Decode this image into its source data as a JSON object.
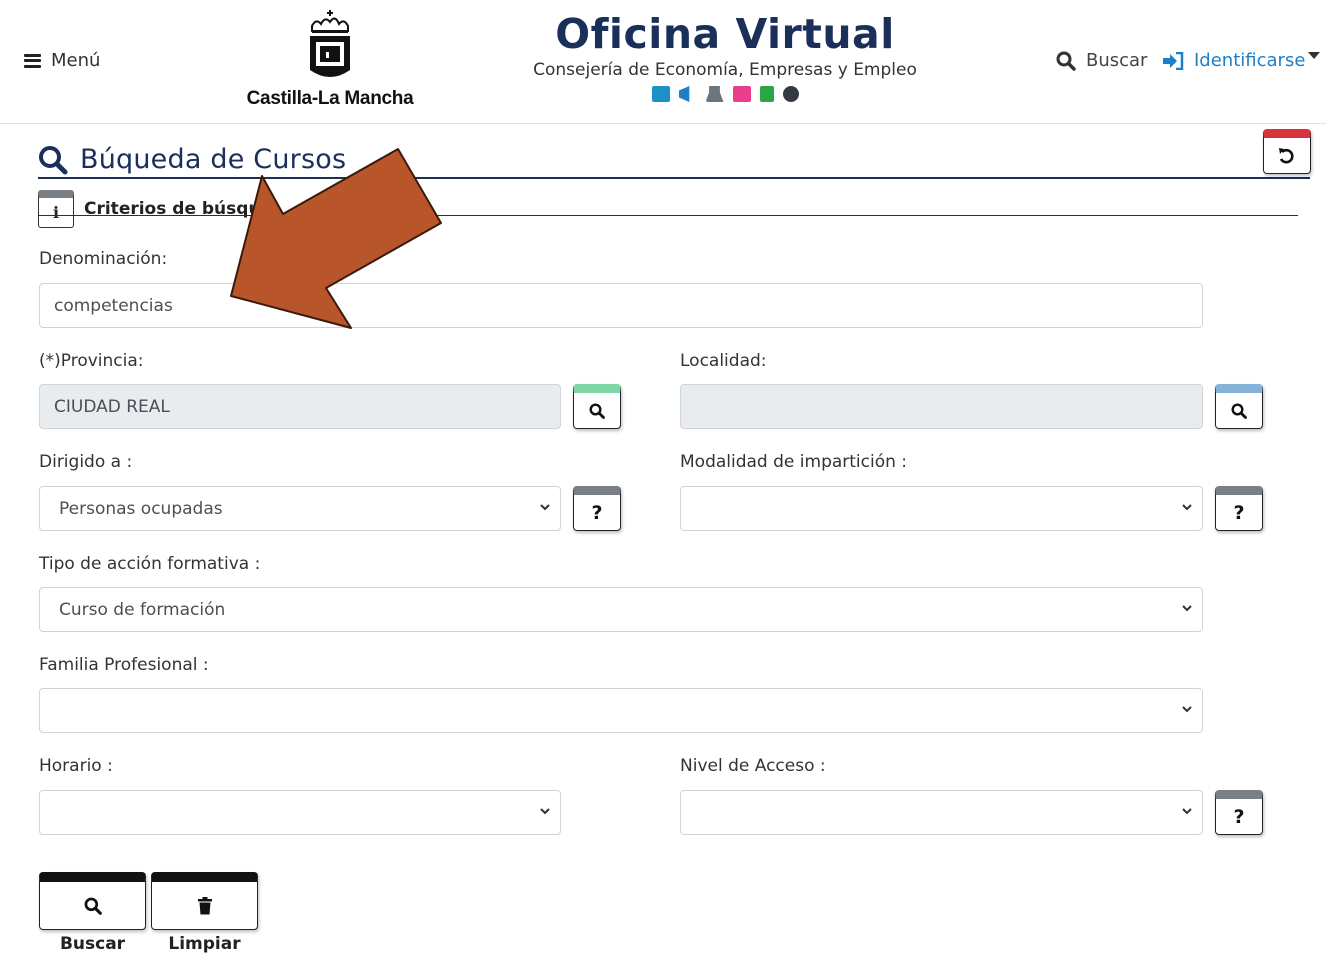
{
  "header": {
    "menu_label": "Menú",
    "logo_text": "Castilla-La Mancha",
    "brand_title": "Oficina Virtual",
    "brand_subtitle": "Consejería de Economía, Empresas y Empleo",
    "brand_icons": [
      {
        "icon": "id-card-icon",
        "color": "#1e90c8"
      },
      {
        "icon": "megaphone-icon",
        "color": "#1e7ec8"
      },
      {
        "icon": "graduate-icon",
        "color": "#6c757d"
      },
      {
        "icon": "list-icon",
        "color": "#e83e8c"
      },
      {
        "icon": "clipboard-icon",
        "color": "#28a745"
      },
      {
        "icon": "cogs-icon",
        "color": "#343a40"
      }
    ],
    "search_label": "Buscar",
    "login_label": "Identificarse"
  },
  "page": {
    "title": "Búqueda de Cursos",
    "criteria_heading": "Criterios de búsque"
  },
  "form": {
    "denominacion": {
      "label": "Denominación:",
      "value": "competencias"
    },
    "provincia": {
      "label": "(*)Provincia:",
      "value": "CIUDAD REAL"
    },
    "localidad": {
      "label": "Localidad:",
      "value": ""
    },
    "dirigido": {
      "label": "Dirigido a :",
      "value": "Personas ocupadas"
    },
    "modalidad": {
      "label": "Modalidad de impartición :",
      "value": ""
    },
    "tipo_accion": {
      "label": "Tipo de acción formativa :",
      "value": "Curso de formación"
    },
    "familia": {
      "label": "Familia Profesional :",
      "value": ""
    },
    "horario": {
      "label": "Horario :",
      "value": ""
    },
    "nivel": {
      "label": "Nivel de Acceso :",
      "value": ""
    },
    "help_glyph": "?"
  },
  "actions": {
    "search_label": "Buscar",
    "clear_label": "Limpiar"
  },
  "colors": {
    "navy": "#1a2f5a",
    "link_blue": "#1e7ec8",
    "reset_red": "#d9343c",
    "arrow_orange": "#b9552b"
  }
}
